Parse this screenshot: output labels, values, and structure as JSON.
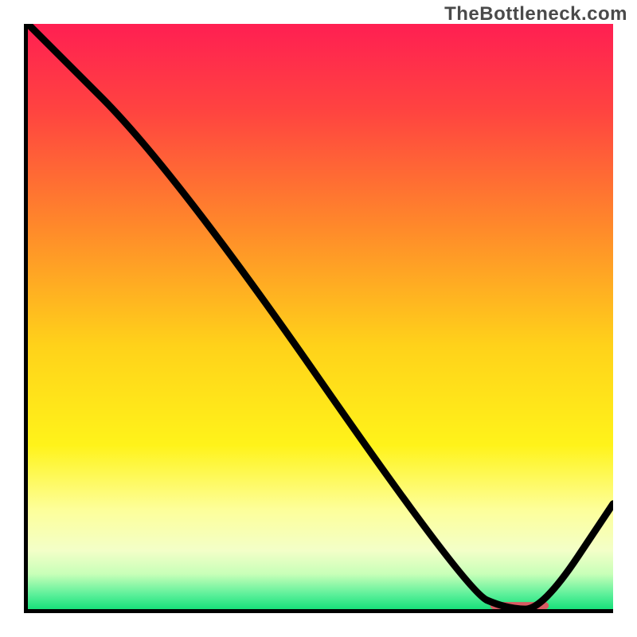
{
  "watermark": "TheBottleneck.com",
  "chart_data": {
    "type": "line",
    "title": "",
    "xlabel": "",
    "ylabel": "",
    "xlim": [
      0,
      100
    ],
    "ylim": [
      0,
      100
    ],
    "grid": false,
    "legend": false,
    "series": [
      {
        "name": "bottleneck-curve",
        "x": [
          0,
          25,
          75,
          82,
          88,
          100
        ],
        "y": [
          100,
          75,
          3,
          0,
          0,
          18
        ]
      }
    ],
    "marker": {
      "name": "optimal-range",
      "x_start": 79,
      "x_end": 89,
      "y": 0
    },
    "gradient_stops": [
      {
        "offset": 0.0,
        "color": "#ff1f52"
      },
      {
        "offset": 0.15,
        "color": "#ff4440"
      },
      {
        "offset": 0.35,
        "color": "#ff8a2a"
      },
      {
        "offset": 0.55,
        "color": "#ffd21a"
      },
      {
        "offset": 0.72,
        "color": "#fff31a"
      },
      {
        "offset": 0.83,
        "color": "#fdff9a"
      },
      {
        "offset": 0.9,
        "color": "#f3ffc8"
      },
      {
        "offset": 0.94,
        "color": "#c8ffb8"
      },
      {
        "offset": 0.975,
        "color": "#5cf09a"
      },
      {
        "offset": 1.0,
        "color": "#18e07a"
      }
    ]
  }
}
